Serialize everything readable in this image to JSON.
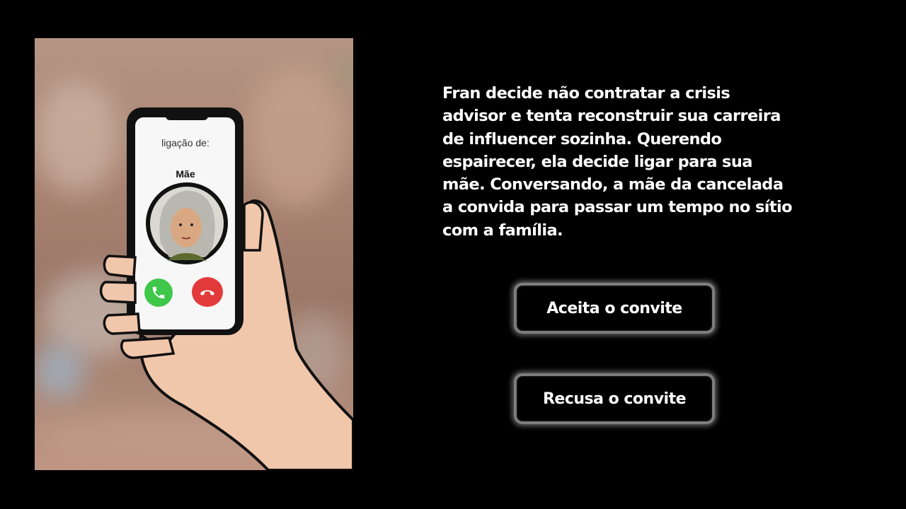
{
  "scene": {
    "narration": "Fran decide não contratar a crisis advisor e tenta reconstruir sua carreira de influencer sozinha. Querendo espairecer, ela decide ligar para sua mãe. Conversando, a mãe da cancelada a convida para passar um tempo no sítio com a família."
  },
  "phone": {
    "call_label": "ligação de:",
    "caller_name": "Mãe",
    "accept_icon": "phone-accept-icon",
    "decline_icon": "phone-decline-icon"
  },
  "choices": {
    "accept_label": "Aceita o convite",
    "decline_label": "Recusa o convite"
  },
  "colors": {
    "background": "#000000",
    "button_border": "#7d7d7d",
    "accept_green": "#3fc74a",
    "decline_red": "#e23a3a"
  }
}
